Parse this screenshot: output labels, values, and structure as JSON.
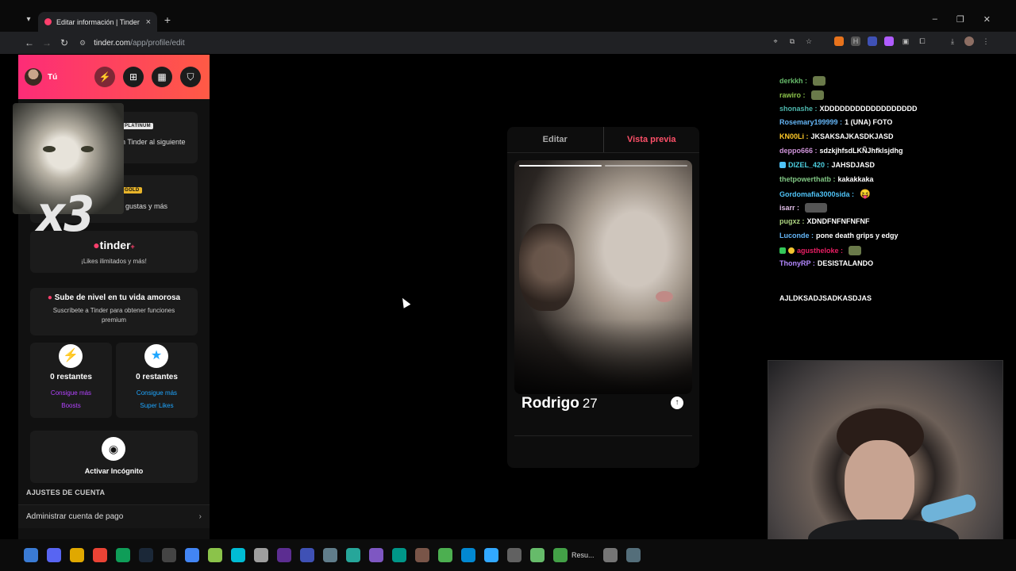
{
  "browser": {
    "tab_title": "Editar información | Tinder",
    "url_host": "tinder.com",
    "url_path": "/app/profile/edit",
    "controls": {
      "minimize": "–",
      "restore": "❐",
      "close": "✕"
    },
    "tab_close": "×",
    "new_tab": "+"
  },
  "sidebar": {
    "user_name": "Tú",
    "header_buttons": [
      "boost-icon",
      "explore-icon",
      "briefcase-icon",
      "shield-icon"
    ],
    "platinum": {
      "badge": "PLATINUM",
      "text": "n Tinder al siguiente"
    },
    "gold": {
      "badge": "GOLD",
      "text": "gustas y más"
    },
    "plus": {
      "logo": "tinder",
      "plus_mark": "+",
      "text": "¡Likes ilimitados y más!"
    },
    "upsell": {
      "title": "Sube de nivel en tu vida amorosa",
      "text_line1": "Suscríbete a Tinder para obtener funciones",
      "text_line2": "premium"
    },
    "boosts": {
      "count": "0 restantes",
      "link_line1": "Consigue más",
      "link_line2": "Boosts"
    },
    "superlikes": {
      "count": "0 restantes",
      "link_line1": "Consigue más",
      "link_line2": "Super Likes"
    },
    "incognito": {
      "label": "Activar Incógnito"
    },
    "section_title": "AJUSTES DE CUENTA",
    "account_row": "Administrar cuenta de pago",
    "accent_color": "#fd3f6c"
  },
  "overlay": {
    "multiplier_text": "x3"
  },
  "preview": {
    "tab_edit": "Editar",
    "tab_preview": "Vista previa",
    "name": "Rodrigo",
    "age": "27",
    "photo_count": 2,
    "active_photo": 0
  },
  "chat": [
    {
      "user": "derkkh",
      "color": "#66bb6a",
      "msg": "",
      "emote": true
    },
    {
      "user": "rawiro",
      "color": "#8bc34a",
      "msg": "",
      "emote": true
    },
    {
      "user": "shonashe",
      "color": "#4db6ac",
      "msg": "XDDDDDDDDDDDDDDDDDD"
    },
    {
      "user": "Rosemary199999",
      "color": "#64b5f6",
      "msg": "1 (UNA) FOTO"
    },
    {
      "user": "KN00Li",
      "color": "#ffca28",
      "msg": "JKSAKSAJKASDKJASD"
    },
    {
      "user": "deppo666",
      "color": "#ce93d8",
      "msg": "sdzkjhfsdLKÑJhfklsjdhg"
    },
    {
      "user": "DIZEL_420",
      "color": "#4dd0e1",
      "msg": "JAHSDJASD",
      "badge": "blue"
    },
    {
      "user": "thetpowerthatb",
      "color": "#81c784",
      "msg": "kakakkaka"
    },
    {
      "user": "Gordomafia3000sida",
      "color": "#4fc3f7",
      "msg": "",
      "emoji": "😝"
    },
    {
      "user": "isarr",
      "color": "#e1bee7",
      "msg": "",
      "emote": true,
      "wide": true
    },
    {
      "user": "pugxz",
      "color": "#aed581",
      "msg": "XDNDFNFNFNFNF"
    },
    {
      "user": "Luconde",
      "color": "#64b5f6",
      "msg": "pone death grips y edgy"
    },
    {
      "user": "agustheloke",
      "color": "#e91e63",
      "msg": "",
      "emote": true,
      "badge": "green"
    },
    {
      "user": "ThonyRP",
      "color": "#b388ff",
      "msg": "DESISTALANDO"
    },
    {
      "user": "",
      "color": "#ffffff",
      "msg": "AJLDKSADJSADKASDJAS"
    }
  ],
  "taskbar": {
    "items": [
      "windows-icon",
      "discord-icon",
      "explorer-icon",
      "chrome-icon",
      "edge-icon",
      "steam-icon",
      "obs-icon",
      "app-c-icon",
      "app-g-icon",
      "app-s-icon",
      "app-ball-icon",
      "vs-icon",
      "app-a-icon",
      "app-b-icon",
      "app-c2-icon",
      "app-d-icon",
      "app-e-icon",
      "app-f-icon",
      "minecraft-icon",
      "app-h-icon",
      "photoshop-icon",
      "app-i-icon",
      "app-j-icon",
      "app-k-icon",
      "app-l-icon",
      "app-m-icon"
    ],
    "label": "Resu..."
  },
  "colors": {
    "tinder_pink": "#fd3f6c",
    "boost_purple": "#b343ff",
    "super_blue": "#1ea6ff"
  }
}
